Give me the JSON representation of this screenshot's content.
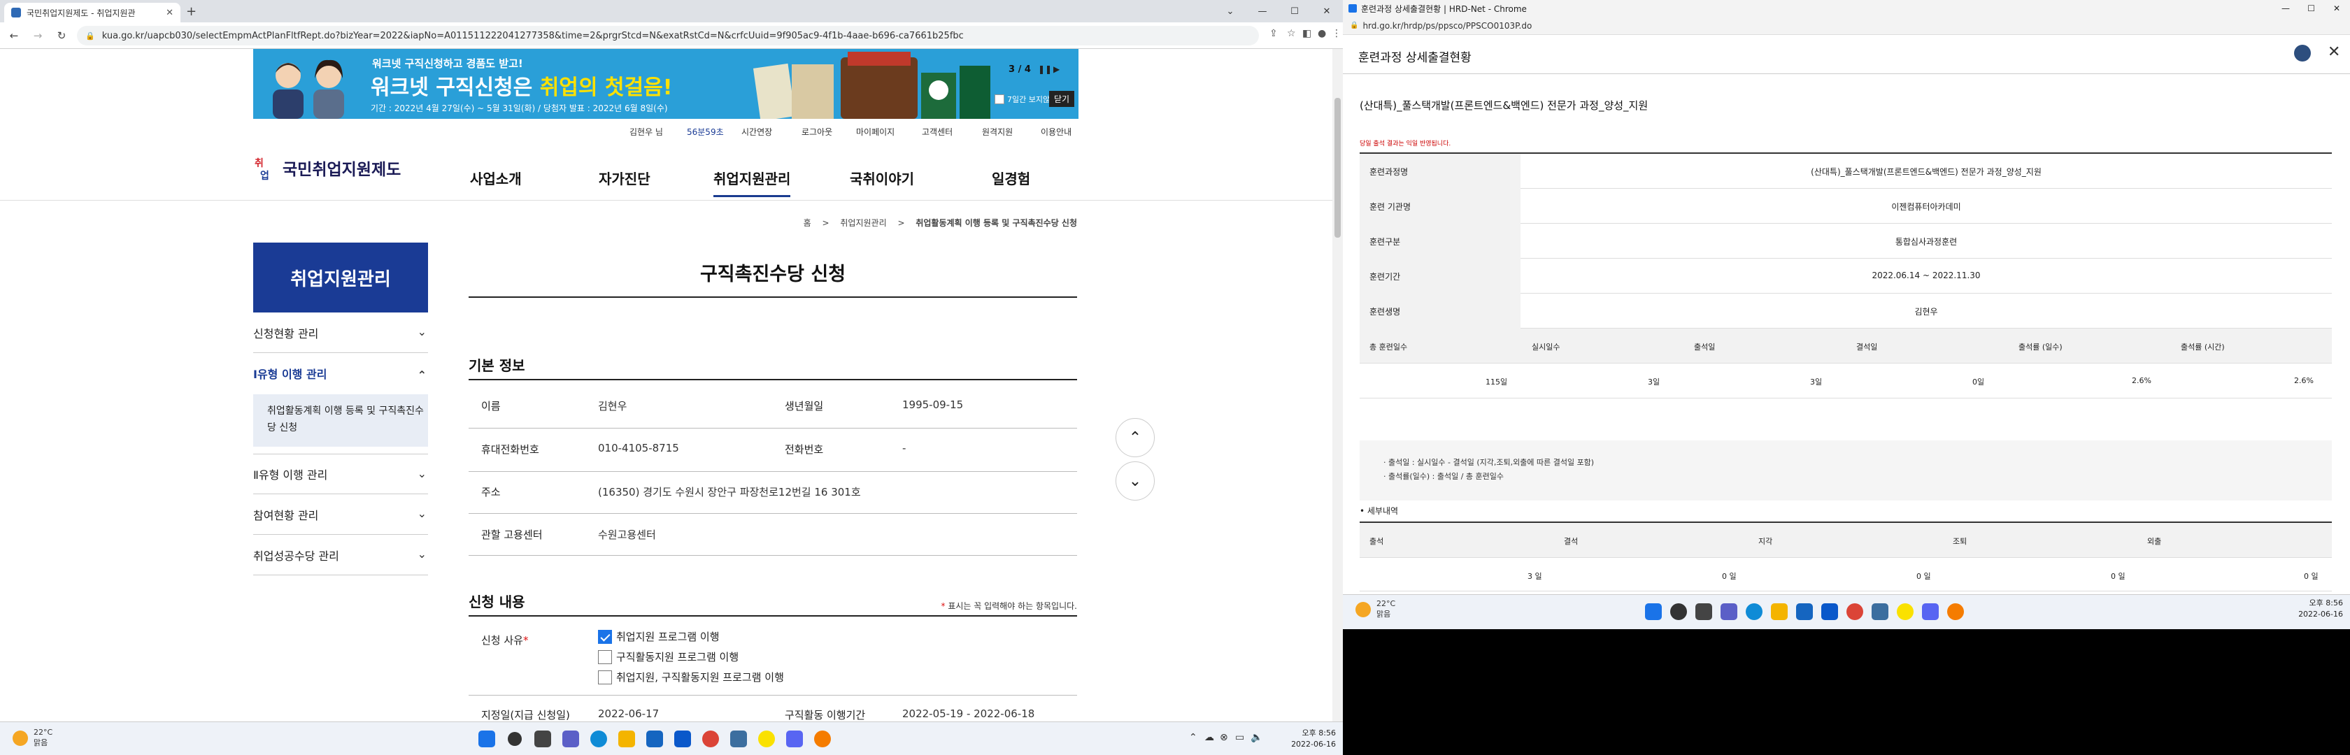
{
  "left": {
    "tab": {
      "title": "국민취업지원제도 - 취업지원관"
    },
    "url": "kua.go.kr/uapcb030/selectEmpmActPlanFltfRept.do?bizYear=2022&iapNo=A011511222041277358&time=2&prgrStcd=N&exatRstCd=N&crfcUuid=9f905ac9-4f1b-4aae-b696-ca7661b25fbc",
    "banner": {
      "line1": "워크넷 구직신청하고 경품도 받고!",
      "line2_pre": "워크넷 구직신청은 ",
      "line2_hl": "취업의 첫걸음!",
      "line3": "기간 : 2022년 4월 27일(수) ~ 5월 31일(화) / 당첨자 발표 : 2022년 6월 8일(수)",
      "page": "3 / 4",
      "check_label": "7일간 보지않기",
      "close_label": "닫기"
    },
    "util": {
      "user": "김현우 님",
      "time": "56분59초",
      "extend": "시간연장",
      "logout": "로그아웃",
      "mypage": "마이페이지",
      "support": "고객센터",
      "remote": "원격지원",
      "guide": "이용안내"
    },
    "logo": "국민취업지원제도",
    "gnb": [
      "사업소개",
      "자가진단",
      "취업지원관리",
      "국취이야기",
      "일경험"
    ],
    "breadcrumb": [
      "홈",
      "취업지원관리",
      "취업활동계획 이행 등록 및 구직촉진수당 신청"
    ],
    "lnb": {
      "head": "취업지원관리",
      "items": [
        "신청현황 관리",
        "Ⅰ유형 이행 관리",
        "Ⅱ유형 이행 관리",
        "참여현황 관리",
        "취업성공수당 관리"
      ],
      "sub": "취업활동계획 이행 등록 및 구직촉진수당 신청"
    },
    "title": "구직촉진수당 신청",
    "basic": {
      "heading": "기본 정보",
      "name_label": "이름",
      "name": "김현우",
      "birth_label": "생년월일",
      "birth": "1995-09-15",
      "phone_label": "휴대전화번호",
      "phone": "010-4105-8715",
      "tel_label": "전화번호",
      "tel": "-",
      "addr_label": "주소",
      "addr": "(16350) 경기도 수원시 장안구 파장천로12번길 16 301호",
      "center_label": "관할 고용센터",
      "center": "수원고용센터"
    },
    "apply": {
      "heading": "신청 내용",
      "note_star": "*",
      "note": " 표시는 꼭 입력해야 하는 항목입니다.",
      "reason_label": "신청 사유",
      "options": [
        "취업지원 프로그램 이행",
        "구직활동지원 프로그램 이행",
        "취업지원, 구직활동지원 프로그램 이행"
      ],
      "date_label": "지정일(지급 신청일)",
      "date": "2022-06-17",
      "period_label": "구직활동 이행기간",
      "period": "2022-05-19 - 2022-06-18"
    },
    "taskbar": {
      "temp": "22°C",
      "cond": "맑음",
      "time": "오후 8:56",
      "date": "2022-06-16"
    }
  },
  "right": {
    "window_title": "훈련과정 상세출결현황 | HRD-Net - Chrome",
    "url": "hrd.go.kr/hrdp/ps/ppsco/PPSCO0103P.do",
    "header": "훈련과정 상세출결현황",
    "course": "(산대특)_풀스택개발(프론트엔드&백엔드) 전문가 과정_양성_지원",
    "note": "당일 출석 결과는 익일 반영됩니다.",
    "rows": [
      {
        "k": "훈련과정명",
        "v": "(산대특)_풀스택개발(프론트엔드&백엔드) 전문가 과정_양성_지원"
      },
      {
        "k": "훈련 기관명",
        "v": "이젠컴퓨터아카데미"
      },
      {
        "k": "훈련구분",
        "v": "통합심사과정훈련"
      },
      {
        "k": "훈련기간",
        "v": "2022.06.14 ~ 2022.11.30"
      },
      {
        "k": "훈련생명",
        "v": "김현우"
      }
    ],
    "stats_head": [
      "총 훈련일수",
      "실시일수",
      "출석일",
      "결석일",
      "출석률 (일수)",
      "출석률 (시간)"
    ],
    "stats": [
      "115일",
      "3일",
      "3일",
      "0일",
      "2.6%",
      "2.6%"
    ],
    "info1": "· 출석일 : 실시일수 - 결석일 (지각,조퇴,외출에 따른 결석일 포함)",
    "info2": "· 출석률(일수) : 출석일 / 총 훈련일수",
    "detail_label": "• 세부내역",
    "detail_head": [
      "출석",
      "결석",
      "지각",
      "조퇴",
      "외출"
    ],
    "detail": [
      "3 일",
      "0 일",
      "0 일",
      "0 일",
      "0 일"
    ],
    "taskbar": {
      "temp": "22°C",
      "cond": "맑음",
      "time": "오후 8:56",
      "date": "2022-06-16"
    }
  }
}
